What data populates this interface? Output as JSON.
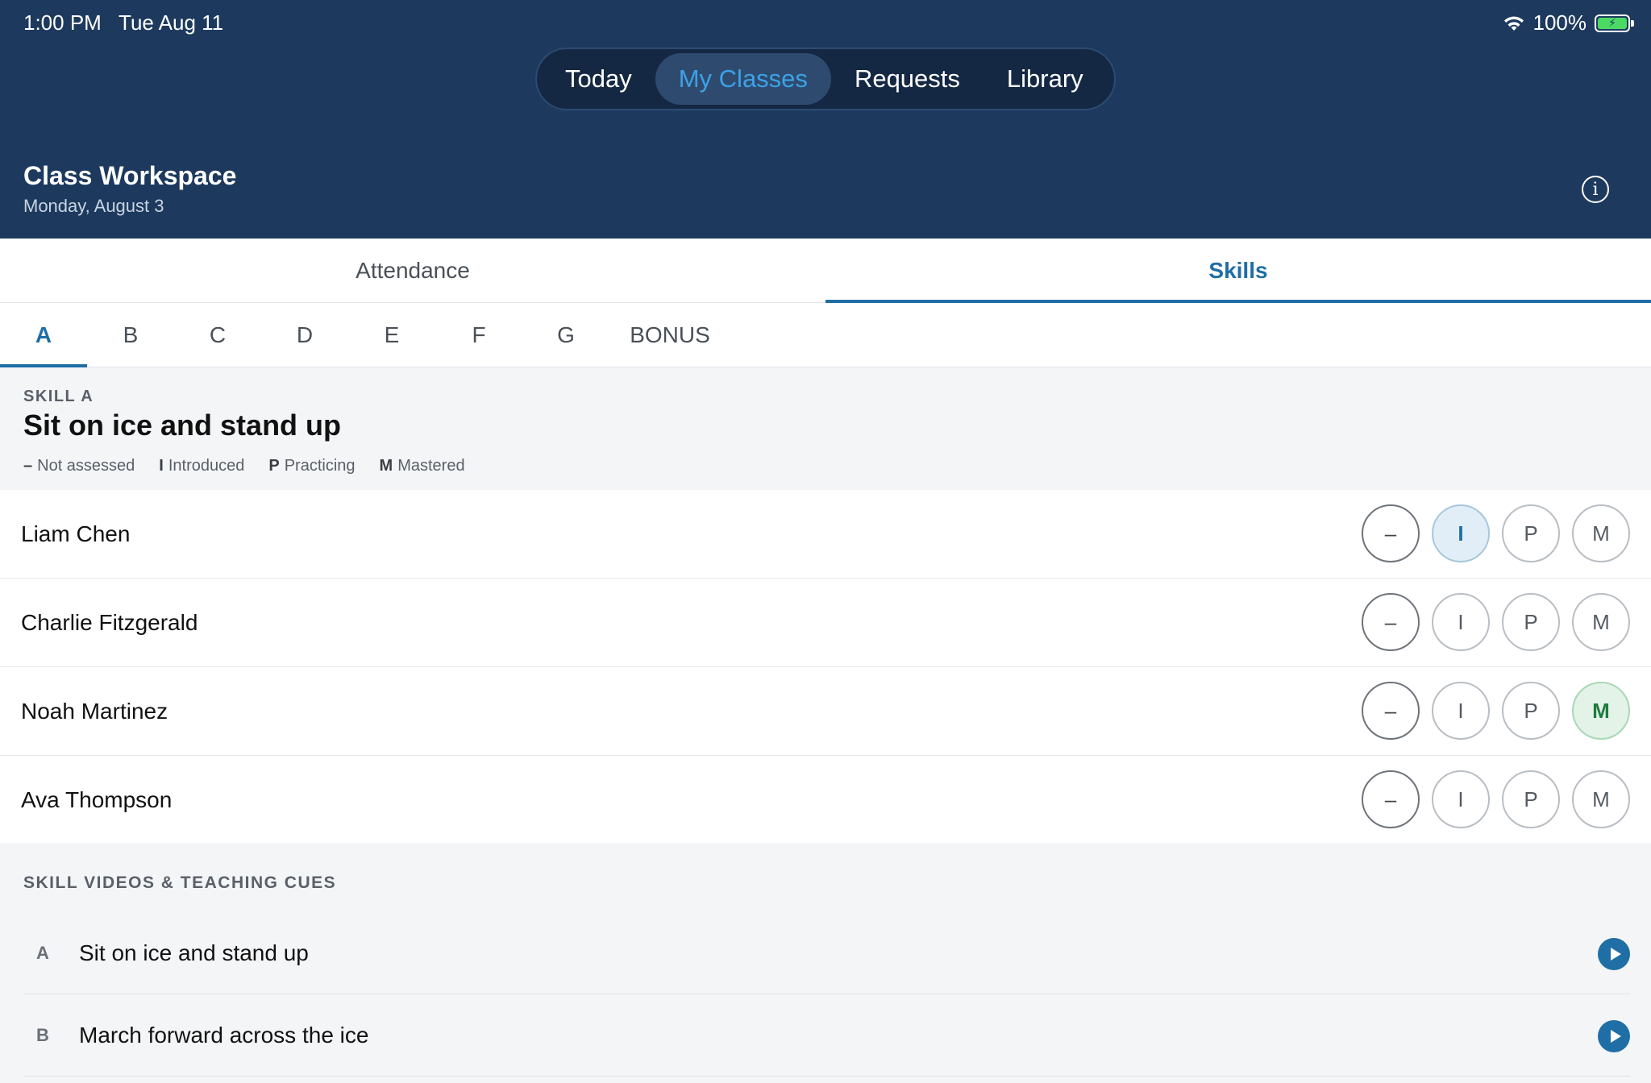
{
  "status_bar": {
    "time": "1:00 PM",
    "date": "Tue Aug 11",
    "battery": "100%"
  },
  "nav": {
    "segments": [
      {
        "label": "Today",
        "active": false
      },
      {
        "label": "My Classes",
        "active": true
      },
      {
        "label": "Requests",
        "active": false
      },
      {
        "label": "Library",
        "active": false
      }
    ]
  },
  "workspace": {
    "title": "Class Workspace",
    "date": "Monday, August 3"
  },
  "main_tabs": [
    {
      "label": "Attendance",
      "active": false
    },
    {
      "label": "Skills",
      "active": true
    }
  ],
  "skill_tabs": [
    {
      "label": "A",
      "active": true
    },
    {
      "label": "B",
      "active": false
    },
    {
      "label": "C",
      "active": false
    },
    {
      "label": "D",
      "active": false
    },
    {
      "label": "E",
      "active": false
    },
    {
      "label": "F",
      "active": false
    },
    {
      "label": "G",
      "active": false
    },
    {
      "label": "BONUS",
      "active": false
    }
  ],
  "skill": {
    "eyebrow": "SKILL A",
    "title": "Sit on ice and stand up",
    "legend": [
      {
        "key": "–",
        "label": "Not assessed"
      },
      {
        "key": "I",
        "label": "Introduced"
      },
      {
        "key": "P",
        "label": "Practicing"
      },
      {
        "key": "M",
        "label": "Mastered"
      }
    ]
  },
  "score_labels": [
    "–",
    "I",
    "P",
    "M"
  ],
  "students": [
    {
      "name": "Liam Chen",
      "selected": "I"
    },
    {
      "name": "Charlie Fitzgerald",
      "selected": ""
    },
    {
      "name": "Noah Martinez",
      "selected": "M"
    },
    {
      "name": "Ava Thompson",
      "selected": ""
    }
  ],
  "videos": {
    "title": "SKILL VIDEOS & TEACHING CUES",
    "items": [
      {
        "letter": "A",
        "name": "Sit on ice and stand up"
      },
      {
        "letter": "B",
        "name": "March forward across the ice"
      }
    ]
  },
  "colors": {
    "header_bg": "#1d3a5e",
    "accent": "#1f6ea5",
    "active_segment_text": "#3ea1e6",
    "introduced_bg": "#e2eef7",
    "mastered_bg": "#e3f3e8"
  }
}
